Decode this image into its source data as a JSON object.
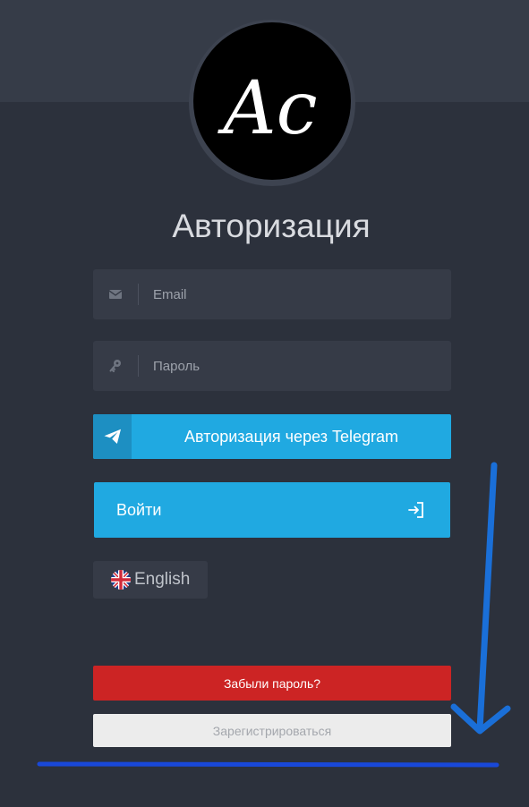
{
  "logo": {
    "text": "Ac"
  },
  "title": "Авторизация",
  "email": {
    "placeholder": "Email",
    "value": ""
  },
  "password": {
    "placeholder": "Пароль",
    "value": ""
  },
  "telegram_button": {
    "label": "Авторизация через Telegram",
    "icon": "paper-plane-icon"
  },
  "login_button": {
    "label": "Войти",
    "icon": "sign-in-icon"
  },
  "language": {
    "label": "English",
    "icon": "uk-flag-icon"
  },
  "forgot_button": {
    "label": "Забыли пароль?"
  },
  "register_button": {
    "label": "Зарегистрироваться"
  },
  "annotation": {
    "arrow_color": "#1a6fd8",
    "underline_color": "#1948d8"
  },
  "colors": {
    "accent": "#20a9e1",
    "danger": "#cc2424",
    "background": "#2c313c"
  }
}
